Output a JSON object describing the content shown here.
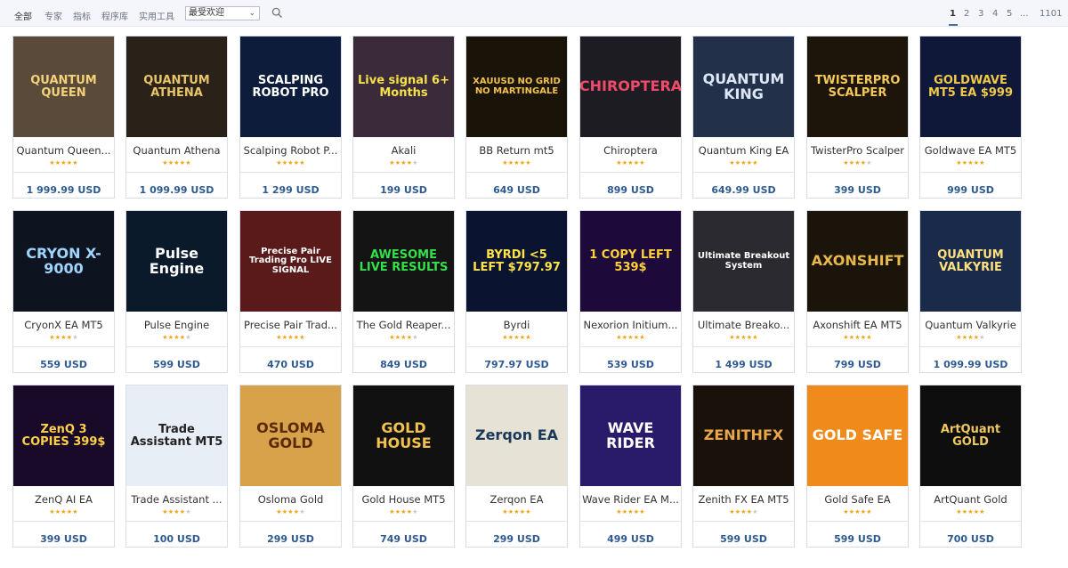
{
  "nav": {
    "tabs": [
      "全部",
      "专家",
      "指标",
      "程序库",
      "实用工具"
    ],
    "sort_value": "最受欢迎"
  },
  "pagination": {
    "pages": [
      "1",
      "2",
      "3",
      "4",
      "5",
      "...",
      "1101"
    ],
    "current": "1"
  },
  "products": [
    {
      "name": "Quantum Queen...",
      "rating": 5,
      "price": "1 999.99 USD",
      "thumb_text": "QUANTUM QUEEN",
      "thumb_bg": "#5a4a3a",
      "thumb_fg": "#f3d27a"
    },
    {
      "name": "Quantum Athena",
      "rating": 5,
      "price": "1 099.99 USD",
      "thumb_text": "QUANTUM ATHENA",
      "thumb_bg": "#2a2218",
      "thumb_fg": "#e8c46a"
    },
    {
      "name": "Scalping Robot P...",
      "rating": 5,
      "price": "1 299 USD",
      "thumb_text": "SCALPING ROBOT PRO",
      "thumb_bg": "#0d1c3a",
      "thumb_fg": "#ffffff"
    },
    {
      "name": "Akali",
      "rating": 4,
      "price": "199 USD",
      "thumb_text": "Live signal 6+ Months",
      "thumb_bg": "#3a2a3a",
      "thumb_fg": "#f5e24a"
    },
    {
      "name": "BB Return mt5",
      "rating": 5,
      "price": "649 USD",
      "thumb_text": "XAUUSD NO GRID NO MARTINGALE",
      "thumb_bg": "#1a1408",
      "thumb_fg": "#f2c14e"
    },
    {
      "name": "Chiroptera",
      "rating": 5,
      "price": "899 USD",
      "thumb_text": "CHIROPTERA",
      "thumb_bg": "#1c1c22",
      "thumb_fg": "#f04a6a"
    },
    {
      "name": "Quantum King EA",
      "rating": 5,
      "price": "649.99 USD",
      "thumb_text": "QUANTUM KING",
      "thumb_bg": "#22304a",
      "thumb_fg": "#dce6f5"
    },
    {
      "name": "TwisterPro Scalper",
      "rating": 4,
      "price": "399 USD",
      "thumb_text": "TWISTERPRO SCALPER",
      "thumb_bg": "#1e150a",
      "thumb_fg": "#f4c85a"
    },
    {
      "name": "Goldwave EA MT5",
      "rating": 5,
      "price": "999 USD",
      "thumb_text": "GOLDWAVE MT5 EA $999",
      "thumb_bg": "#10183a",
      "thumb_fg": "#f2c84a"
    },
    {
      "name": "CryonX EA MT5",
      "rating": 4,
      "price": "559 USD",
      "thumb_text": "CRYON X-9000",
      "thumb_bg": "#0d1420",
      "thumb_fg": "#9fd4ff"
    },
    {
      "name": "Pulse Engine",
      "rating": 4,
      "price": "599 USD",
      "thumb_text": "Pulse Engine",
      "thumb_bg": "#0a1a2a",
      "thumb_fg": "#ffffff"
    },
    {
      "name": "Precise Pair Trad...",
      "rating": 5,
      "price": "470 USD",
      "thumb_text": "Precise Pair Trading Pro LIVE SIGNAL",
      "thumb_bg": "#5a1a1a",
      "thumb_fg": "#ffffff"
    },
    {
      "name": "The Gold Reaper...",
      "rating": 4,
      "price": "849 USD",
      "thumb_text": "AWESOME LIVE RESULTS",
      "thumb_bg": "#141414",
      "thumb_fg": "#34e04a"
    },
    {
      "name": "Byrdi",
      "rating": 5,
      "price": "797.97 USD",
      "thumb_text": "BYRDI <5 LEFT $797.97",
      "thumb_bg": "#0a1430",
      "thumb_fg": "#ffe24a"
    },
    {
      "name": "Nexorion Initium...",
      "rating": 5,
      "price": "539 USD",
      "thumb_text": "1 COPY LEFT 539$",
      "thumb_bg": "#1e0a3a",
      "thumb_fg": "#ffd23a"
    },
    {
      "name": "Ultimate Breako...",
      "rating": 5,
      "price": "1 499 USD",
      "thumb_text": "Ultimate Breakout System",
      "thumb_bg": "#2a2a30",
      "thumb_fg": "#ffffff"
    },
    {
      "name": "Axonshift EA MT5",
      "rating": 5,
      "price": "799 USD",
      "thumb_text": "AXONSHIFT",
      "thumb_bg": "#1a140a",
      "thumb_fg": "#e7b84a"
    },
    {
      "name": "Quantum Valkyrie",
      "rating": 4,
      "price": "1 099.99 USD",
      "thumb_text": "QUANTUM VALKYRIE",
      "thumb_bg": "#1a2a4a",
      "thumb_fg": "#ffe080"
    },
    {
      "name": "ZenQ AI EA",
      "rating": 5,
      "price": "399 USD",
      "thumb_text": "ZenQ 3 COPIES 399$",
      "thumb_bg": "#1a0a2a",
      "thumb_fg": "#ffd04a"
    },
    {
      "name": "Trade Assistant ...",
      "rating": 4,
      "price": "100 USD",
      "thumb_text": "Trade Assistant MT5",
      "thumb_bg": "#e8eef6",
      "thumb_fg": "#222222"
    },
    {
      "name": "Osloma Gold",
      "rating": 4,
      "price": "299 USD",
      "thumb_text": "OSLOMA GOLD",
      "thumb_bg": "#d8a24a",
      "thumb_fg": "#5a2a08"
    },
    {
      "name": "Gold House MT5",
      "rating": 4,
      "price": "749 USD",
      "thumb_text": "GOLD HOUSE",
      "thumb_bg": "#111111",
      "thumb_fg": "#f2c14e"
    },
    {
      "name": "Zerqon EA",
      "rating": 5,
      "price": "299 USD",
      "thumb_text": "Zerqon EA",
      "thumb_bg": "#e6e2d6",
      "thumb_fg": "#1a3a5a"
    },
    {
      "name": "Wave Rider EA M...",
      "rating": 5,
      "price": "499 USD",
      "thumb_text": "WAVE RIDER",
      "thumb_bg": "#2a1a6a",
      "thumb_fg": "#ffffff"
    },
    {
      "name": "Zenith FX EA MT5",
      "rating": 4,
      "price": "599 USD",
      "thumb_text": "ZENITHFX",
      "thumb_bg": "#1a120a",
      "thumb_fg": "#e8a84a"
    },
    {
      "name": "Gold Safe EA",
      "rating": 5,
      "price": "599 USD",
      "thumb_text": "GOLD SAFE",
      "thumb_bg": "#f08a1a",
      "thumb_fg": "#ffffff"
    },
    {
      "name": "ArtQuant Gold",
      "rating": 5,
      "price": "700 USD",
      "thumb_text": "ArtQuant GOLD",
      "thumb_bg": "#0e0e0e",
      "thumb_fg": "#f0c860"
    }
  ],
  "colors": {
    "accent": "#2e5a92",
    "star": "#f0a417",
    "toolbar_bg": "#f4f6fb"
  },
  "icons": {
    "search": "search-icon",
    "dropdown": "chevron-down-icon"
  }
}
